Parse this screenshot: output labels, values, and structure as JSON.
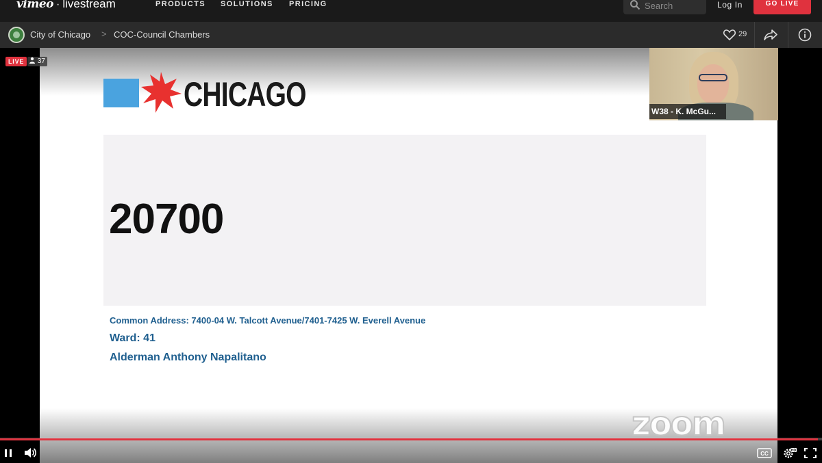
{
  "nav": {
    "brand_vimeo": "vimeo",
    "brand_sep": "·",
    "brand_livestream": "livestream",
    "links": [
      "PRODUCTS",
      "SOLUTIONS",
      "PRICING"
    ],
    "search_placeholder": "Search",
    "login": "Log In",
    "go_live": "GO LIVE"
  },
  "channel": {
    "breadcrumb": [
      "City of Chicago",
      "COC-Council Chambers"
    ],
    "separator": ">",
    "likes": "29"
  },
  "player": {
    "live_label": "LIVE",
    "viewer_count": "37",
    "progress": 0.995,
    "controls": [
      "pause-icon",
      "volume-icon",
      "closed-captions-icon",
      "settings-hd-icon",
      "fullscreen-icon"
    ],
    "accent_color": "#e0323e"
  },
  "slide": {
    "logo_text": "CHICAGO",
    "ordinance_number": "20700",
    "common_address": "Common Address: 7400-04 W. Talcott Avenue/7401-7425 W. Everell Avenue",
    "ward": "Ward: 41",
    "alderman": "Alderman Anthony Napalitano",
    "watermark": "zoom"
  },
  "participant": {
    "name": "W38 - K. McGu..."
  }
}
